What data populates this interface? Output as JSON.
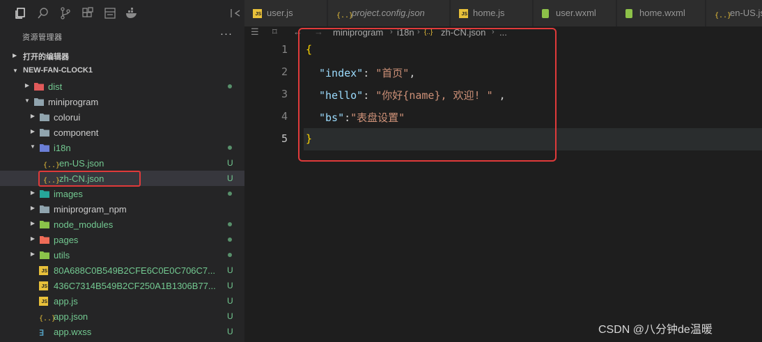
{
  "explorer": {
    "title": "资源管理器",
    "more": "···",
    "open_editors_label": "打开的编辑器",
    "project_label": "NEW-FAN-CLOCK1"
  },
  "tree": [
    {
      "name": "dist",
      "kind": "folder",
      "icon": "dist-folder-icon",
      "status": "dot",
      "collapsed": true
    },
    {
      "name": "miniprogram",
      "kind": "folder",
      "icon": "folder-icon",
      "status": "",
      "collapsed": false
    },
    {
      "name": "colorui",
      "kind": "folder",
      "icon": "folder-icon",
      "status": "",
      "collapsed": true
    },
    {
      "name": "component",
      "kind": "folder",
      "icon": "folder-icon",
      "status": "",
      "collapsed": true
    },
    {
      "name": "i18n",
      "kind": "folder",
      "icon": "i18n-folder-icon",
      "status": "dot",
      "collapsed": false
    },
    {
      "name": "en-US.json",
      "kind": "json",
      "icon": "json-file-icon",
      "status": "U"
    },
    {
      "name": "zh-CN.json",
      "kind": "json",
      "icon": "json-file-icon",
      "status": "U",
      "selected": true
    },
    {
      "name": "images",
      "kind": "folder",
      "icon": "images-folder-icon",
      "status": "dot",
      "collapsed": true
    },
    {
      "name": "miniprogram_npm",
      "kind": "folder",
      "icon": "folder-icon",
      "status": "",
      "collapsed": true
    },
    {
      "name": "node_modules",
      "kind": "folder",
      "icon": "node-modules-folder-icon",
      "status": "dot",
      "collapsed": true
    },
    {
      "name": "pages",
      "kind": "folder",
      "icon": "pages-folder-icon",
      "status": "dot",
      "collapsed": true
    },
    {
      "name": "utils",
      "kind": "folder",
      "icon": "utils-folder-icon",
      "status": "dot",
      "collapsed": true
    },
    {
      "name": "80A688C0B549B2CFE6C0E0C706C7...",
      "kind": "js",
      "icon": "js-file-icon",
      "status": "U"
    },
    {
      "name": "436C7314B549B2CF250A1B1306B77...",
      "kind": "js",
      "icon": "js-file-icon",
      "status": "U"
    },
    {
      "name": "app.js",
      "kind": "js",
      "icon": "js-file-icon",
      "status": "U"
    },
    {
      "name": "app.json",
      "kind": "json",
      "icon": "json-file-icon",
      "status": "U"
    },
    {
      "name": "app.wxss",
      "kind": "css",
      "icon": "css-file-icon",
      "status": "U"
    }
  ],
  "tabs": [
    {
      "label": "user.js",
      "icon": "js-file-icon",
      "kind": "js"
    },
    {
      "label": "project.config.json",
      "icon": "json-file-icon",
      "kind": "json",
      "italic": true
    },
    {
      "label": "home.js",
      "icon": "js-file-icon",
      "kind": "js"
    },
    {
      "label": "user.wxml",
      "icon": "wxml-file-icon",
      "kind": "wxml"
    },
    {
      "label": "home.wxml",
      "icon": "wxml-file-icon",
      "kind": "wxml"
    },
    {
      "label": "en-US.js",
      "icon": "json-file-icon",
      "kind": "json"
    }
  ],
  "breadcrumb": {
    "parts": [
      "miniprogram",
      "i18n",
      "zh-CN.json",
      "..."
    ]
  },
  "editor": {
    "line_numbers": [
      "1",
      "2",
      "3",
      "4",
      "5"
    ],
    "line1": "{",
    "line2_key": "\"index\"",
    "line2_colon": ": ",
    "line2_val": "\"首页\"",
    "line2_comma": ",",
    "line3_key": "\"hello\"",
    "line3_colon": ": ",
    "line3_val": "\"你好{name}, 欢迎! \"",
    "line3_comma": " ,",
    "line4_key": "\"bs\"",
    "line4_colon": ":",
    "line4_val": "\"表盘设置\"",
    "line5": "}"
  },
  "watermark": "CSDN @八分钟de温暖",
  "colors": {
    "accent_highlight": "#e03a3a",
    "git_untracked": "#73c991",
    "js_badge": "#e8c03a",
    "json_key": "#9cdcfe",
    "json_string": "#ce9178",
    "brace": "#ffd700"
  }
}
